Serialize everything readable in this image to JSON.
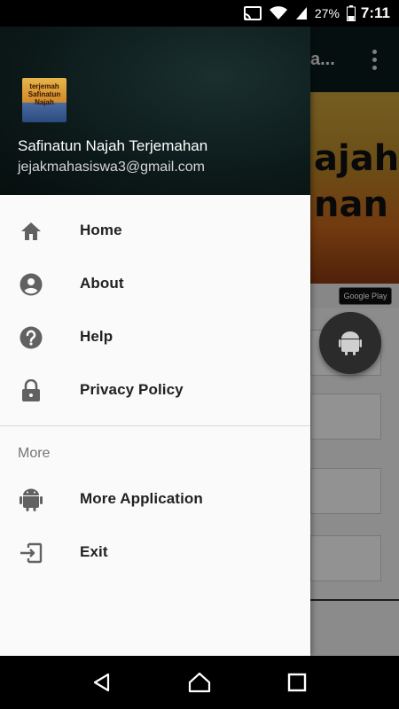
{
  "status_bar": {
    "battery_percent": "27%",
    "time": "7:11",
    "icons": [
      "cast-icon",
      "wifi-icon",
      "signal-icon",
      "battery-icon"
    ]
  },
  "background_app": {
    "title": "a...",
    "banner_text": [
      "ajah",
      "nan"
    ],
    "store_badge": "Google Play"
  },
  "drawer": {
    "header": {
      "avatar_text": "terjemah Safinatun Najah",
      "app_name": "Safinatun Najah Terjemahan",
      "email": "jejakmahasiswa3@gmail.com"
    },
    "items": [
      {
        "label": "Home",
        "icon": "home-icon"
      },
      {
        "label": "About",
        "icon": "account-circle-icon"
      },
      {
        "label": "Help",
        "icon": "help-icon"
      },
      {
        "label": "Privacy Policy",
        "icon": "lock-icon"
      }
    ],
    "section_title": "More",
    "more_items": [
      {
        "label": "More Application",
        "icon": "android-icon"
      },
      {
        "label": "Exit",
        "icon": "exit-icon"
      }
    ]
  },
  "colors": {
    "drawer_bg": "#fafafa",
    "header_bg": "#0d1b1b",
    "icon_gray": "#616161",
    "label_text": "#212121",
    "section_text": "#757575"
  },
  "nav_bar": {
    "icons": [
      "back-icon",
      "home-nav-icon",
      "recents-icon"
    ]
  }
}
